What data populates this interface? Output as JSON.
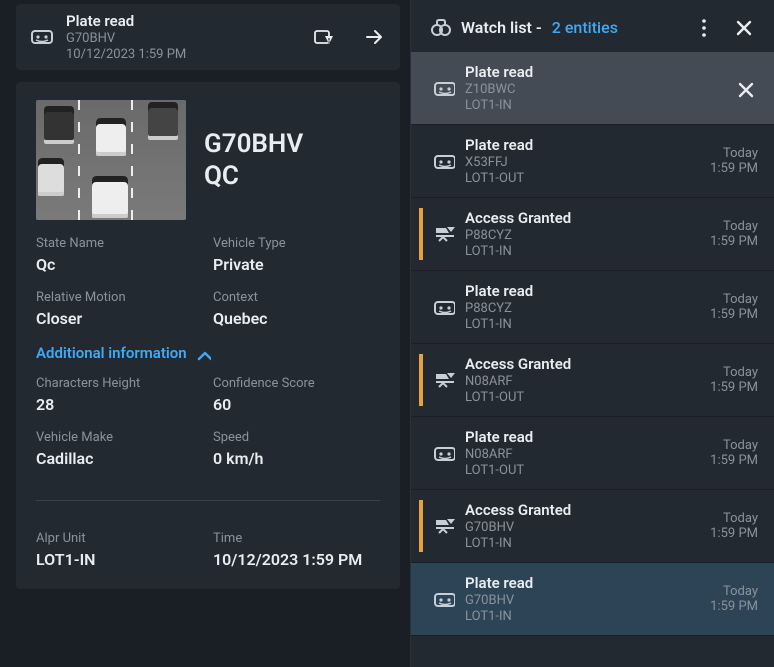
{
  "header": {
    "title": "Plate read",
    "plate": "G70BHV",
    "datetime": "10/12/2023 1:59 PM"
  },
  "detail": {
    "plate": "G70BHV",
    "region": "QC",
    "fields1": [
      {
        "label": "State Name",
        "value": "Qc"
      },
      {
        "label": "Vehicle Type",
        "value": "Private"
      },
      {
        "label": "Relative Motion",
        "value": "Closer"
      },
      {
        "label": "Context",
        "value": "Quebec"
      }
    ],
    "addl_label": "Additional information",
    "fields2": [
      {
        "label": "Characters Height",
        "value": "28"
      },
      {
        "label": "Confidence Score",
        "value": "60"
      },
      {
        "label": "Vehicle Make",
        "value": "Cadillac"
      },
      {
        "label": "Speed",
        "value": "0 km/h"
      },
      {
        "label": "Alpr Unit",
        "value": "LOT1-IN"
      },
      {
        "label": "Time",
        "value": "10/12/2023 1:59 PM"
      }
    ]
  },
  "watchlist": {
    "title": "Watch list -",
    "count_label": "2 entities",
    "items": [
      {
        "type": "Plate read",
        "plate": "Z10BWC",
        "lot": "LOT1-IN",
        "dayline": "",
        "time": "",
        "bar": "blank",
        "pinned": true,
        "icon": "plate"
      },
      {
        "type": "Plate read",
        "plate": "X53FFJ",
        "lot": "LOT1-OUT",
        "dayline": "Today",
        "time": "1:59 PM",
        "bar": "blank",
        "icon": "plate"
      },
      {
        "type": "Access Granted",
        "plate": "P88CYZ",
        "lot": "LOT1-IN",
        "dayline": "Today",
        "time": "1:59 PM",
        "bar": "orange",
        "icon": "access"
      },
      {
        "type": "Plate read",
        "plate": "P88CYZ",
        "lot": "LOT1-IN",
        "dayline": "Today",
        "time": "1:59 PM",
        "bar": "blank",
        "icon": "plate"
      },
      {
        "type": "Access Granted",
        "plate": "N08ARF",
        "lot": "LOT1-OUT",
        "dayline": "Today",
        "time": "1:59 PM",
        "bar": "orange",
        "icon": "access"
      },
      {
        "type": "Plate read",
        "plate": "N08ARF",
        "lot": "LOT1-OUT",
        "dayline": "Today",
        "time": "1:59 PM",
        "bar": "blank",
        "icon": "plate"
      },
      {
        "type": "Access Granted",
        "plate": "G70BHV",
        "lot": "LOT1-IN",
        "dayline": "Today",
        "time": "1:59 PM",
        "bar": "orange",
        "icon": "access"
      },
      {
        "type": "Plate read",
        "plate": "G70BHV",
        "lot": "LOT1-IN",
        "dayline": "Today",
        "time": "1:59 PM",
        "bar": "blank",
        "selected": true,
        "icon": "plate"
      }
    ]
  }
}
